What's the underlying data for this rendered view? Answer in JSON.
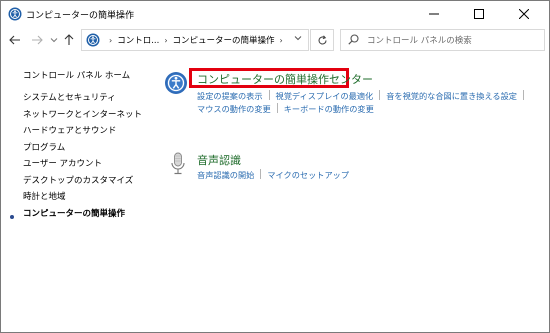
{
  "window": {
    "title": "コンピューターの簡単操作"
  },
  "address_bar": {
    "crumbs": [
      "コントロ...",
      "コンピューターの簡単操作"
    ]
  },
  "search": {
    "placeholder": "コントロール パネルの検索"
  },
  "sidebar": {
    "home_label": "コントロール パネル ホーム",
    "items": [
      {
        "label": "システムとセキュリティ"
      },
      {
        "label": "ネットワークとインターネット"
      },
      {
        "label": "ハードウェアとサウンド"
      },
      {
        "label": "プログラム"
      },
      {
        "label": "ユーザー アカウント"
      },
      {
        "label": "デスクトップのカスタマイズ"
      },
      {
        "label": "時計と地域"
      },
      {
        "label": "コンピューターの簡単操作",
        "current": true
      }
    ]
  },
  "categories": [
    {
      "title": "コンピューターの簡単操作センター",
      "icon": "ease-of-access-icon",
      "links_row1": [
        "設定の提案の表示",
        "視覚ディスプレイの最適化",
        "音を視覚的な合図に置き換える設定"
      ],
      "links_row2": [
        "マウスの動作の変更",
        "キーボードの動作の変更"
      ]
    },
    {
      "title": "音声認識",
      "icon": "microphone-icon",
      "links_row1": [
        "音声認識の開始",
        "マイクのセットアップ"
      ]
    }
  ],
  "colors": {
    "link": "#2b6cb0",
    "category_title": "#1e6b2a",
    "highlight_box": "#e3000f"
  }
}
